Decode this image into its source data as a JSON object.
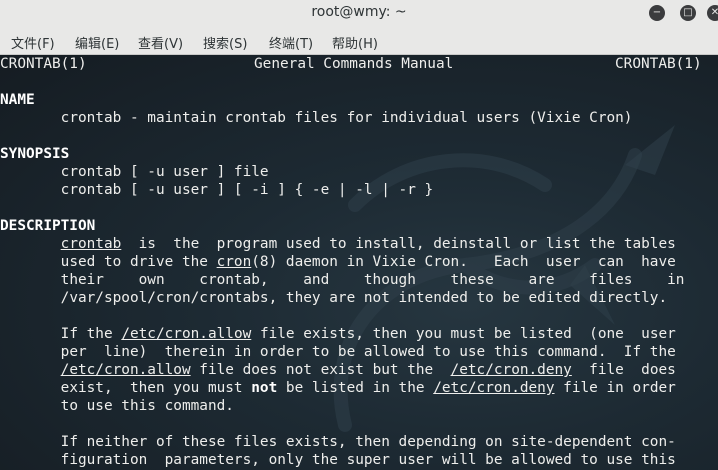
{
  "window": {
    "title": "root@wmy: ~",
    "buttons": {
      "minimize": "−",
      "maximize": "□",
      "close": "✕"
    }
  },
  "menu": [
    "文件(F)",
    "编辑(E)",
    "查看(V)",
    "搜索(S)",
    "终端(T)",
    "帮助(H)"
  ],
  "man": {
    "header_left": "CRONTAB(1)",
    "header_center": "General Commands Manual",
    "header_right": "CRONTAB(1)",
    "name_heading": "NAME",
    "name_text": "crontab - maintain crontab files for individual users (Vixie Cron)",
    "synopsis_heading": "SYNOPSIS",
    "synopsis_lines": [
      "crontab [ -u user ] file",
      "crontab [ -u user ] [ -i ] { -e | -l | -r }"
    ],
    "description_heading": "DESCRIPTION",
    "p1": {
      "l1_link": "crontab",
      "l1_rest": "  is  the  program used to install, deinstall or list the tables",
      "l2_a": "used to drive the ",
      "l2_link": "cron",
      "l2_b": "(8) daemon in Vixie Cron.   Each  user  can  have",
      "l3": "their    own    crontab,    and    though    these    are    files    in",
      "l4": "/var/spool/cron/crontabs, they are not intended to be edited directly."
    },
    "p2": {
      "l1_a": "If the ",
      "l1_link": "/etc/cron.allow",
      "l1_b": " file exists, then you must be listed  (one  user",
      "l2": "per  line)  therein in order to be allowed to use this command.  If the",
      "l3_link1": "/etc/cron.allow",
      "l3_b": " file does not exist but the  ",
      "l3_link2": "/etc/cron.deny",
      "l3_c": "  file  does",
      "l4_a": "exist,  then you must ",
      "l4_bold": "not",
      "l4_b": " be listed in the ",
      "l4_link": "/etc/cron.deny",
      "l4_c": " file in order",
      "l5": "to use this command."
    },
    "p3": {
      "l1": "If neither of these files exists, then depending on site-dependent con-",
      "l2": "figuration  parameters, only the super user will be allowed to use this"
    }
  },
  "colors": {
    "terminal_bg": "#1a2229",
    "text": "#eeeeec",
    "titlebar": "#e8e8e7"
  },
  "icons": [
    "minimize-icon",
    "maximize-icon",
    "close-icon",
    "kali-dragon-watermark"
  ]
}
